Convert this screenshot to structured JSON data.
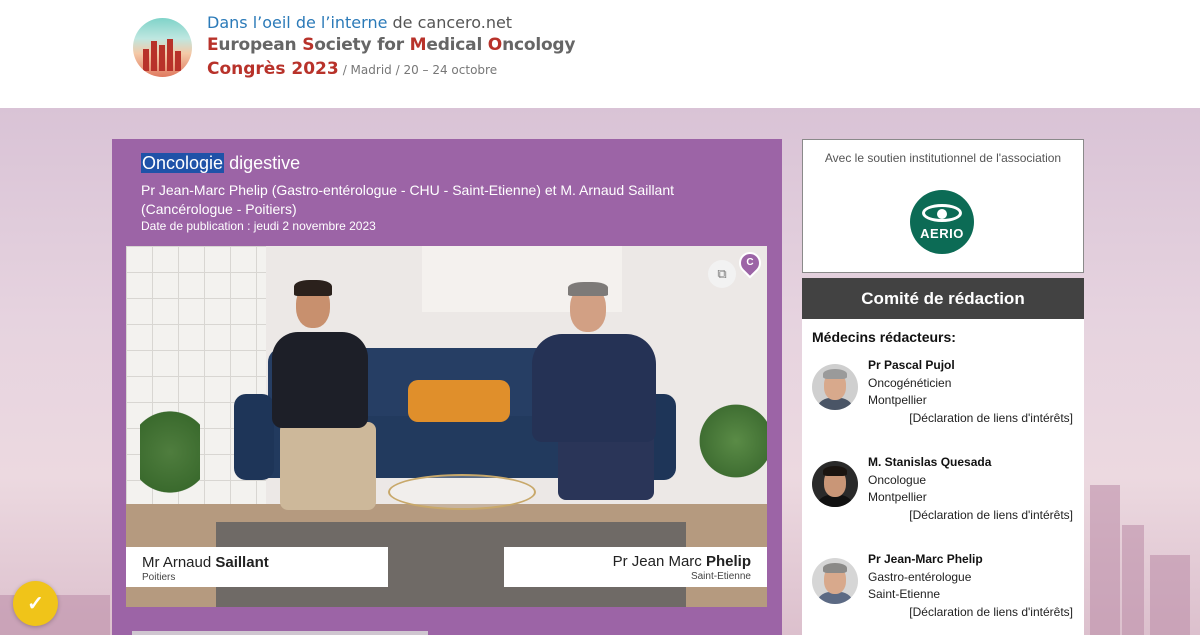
{
  "header": {
    "tagline_highlight": "Dans l’oeil de l’interne",
    "tagline_rest": " de cancero.net",
    "society_letters": [
      "E",
      "uropean ",
      "S",
      "ociety for ",
      "M",
      "edical ",
      "O",
      "ncology"
    ],
    "congres": "Congrès 2023",
    "place": "/ Madrid / 20 – 24 octobre"
  },
  "article": {
    "title_highlight": "Oncologie",
    "title_rest": " digestive",
    "authors": "Pr Jean-Marc Phelip (Gastro-entérologue - CHU - Saint-Etienne) et M. Arnaud Saillant (Cancérologue - Poitiers)",
    "pubdate": "Date de publication : jeudi 2 novembre 2023"
  },
  "video": {
    "left_name_first": "Mr Arnaud ",
    "left_name_last": "Saillant",
    "left_city": "Poitiers",
    "right_name_first": "Pr Jean Marc ",
    "right_name_last": "Phelip",
    "right_city": "Saint-Etienne",
    "pin_letter": "C"
  },
  "sponsor": {
    "label": "Avec le soutien institutionnel de l'association",
    "logo_text": "AERIO"
  },
  "comite": {
    "title": "Comité de rédaction",
    "subtitle": "Médecins rédacteurs:",
    "doctors": [
      {
        "name": "Pr Pascal Pujol",
        "specialty": "Oncogénéticien",
        "city": "Montpellier",
        "link": "[Déclaration de liens d'intérêts]"
      },
      {
        "name": "M. Stanislas Quesada",
        "specialty": "Oncologue",
        "city": "Montpellier",
        "link": "[Déclaration de liens d'intérêts]"
      },
      {
        "name": "Pr Jean-Marc Phelip",
        "specialty": "Gastro-entérologue",
        "city": "Saint-Etienne",
        "link": "[Déclaration de liens d'intérêts]"
      }
    ]
  },
  "colors": {
    "brand_red": "#b8322a",
    "brand_blue": "#2b7ab8",
    "card_purple": "#9c64a6",
    "comite_header": "#424242",
    "aerio_green": "#0c6b55",
    "fab_yellow": "#f0c419"
  },
  "icons": {
    "save": "bookmark-add-icon",
    "pin": "location-pin-icon",
    "fab": "checkmark-icon"
  }
}
